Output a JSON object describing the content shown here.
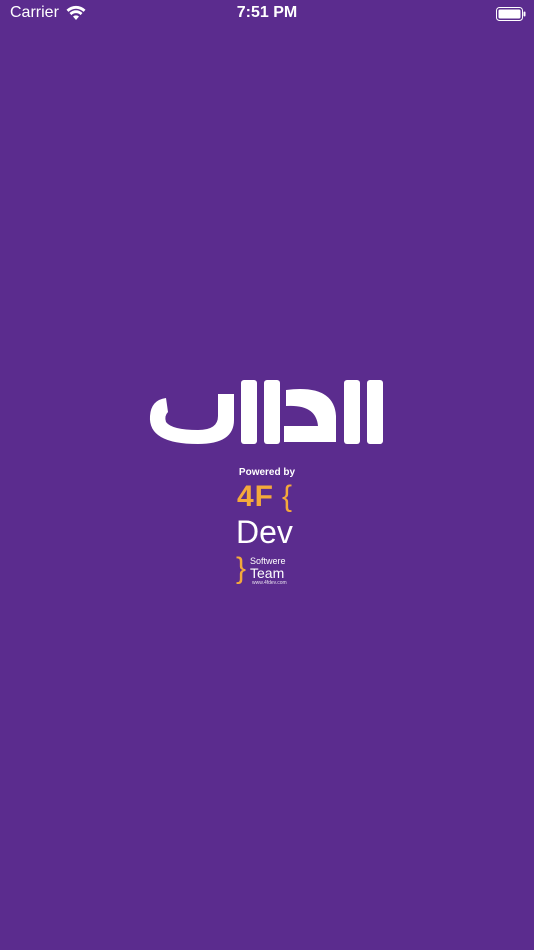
{
  "status_bar": {
    "carrier": "Carrier",
    "time": "7:51 PM",
    "wifi_icon": "wifi-icon",
    "battery_icon": "battery-icon"
  },
  "logo": {
    "text": "الدالی",
    "color": "#ffffff"
  },
  "credits": {
    "powered_by": "Powered by",
    "brand_4f": "4F",
    "brace_open": "{",
    "brand_dev": "Dev",
    "brace_close": "}",
    "softwere": "Softwere",
    "team": "Team",
    "url": "www.4fdev.com"
  },
  "colors": {
    "background": "#5b2c8e",
    "accent": "#f4a93b",
    "text": "#ffffff"
  }
}
